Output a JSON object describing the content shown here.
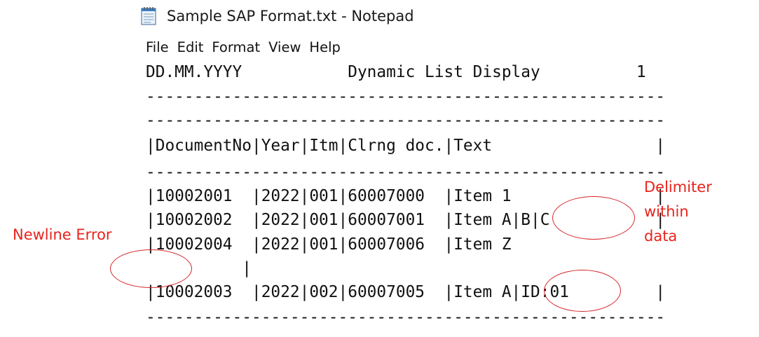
{
  "window": {
    "title": "Sample SAP Format.txt - Notepad",
    "icon": "notepad-icon"
  },
  "menu": [
    "File",
    "Edit",
    "Format",
    "View",
    "Help"
  ],
  "content": {
    "lines": [
      "DD.MM.YYYY           Dynamic List Display          1",
      "------------------------------------------------------",
      "------------------------------------------------------",
      "|DocumentNo|Year|Itm|Clrng doc.|Text                 |",
      "------------------------------------------------------",
      "|10002001  |2022|001|60007000  |Item 1               |",
      "|10002002  |2022|001|60007001  |Item A|B|C           |",
      "|10002004  |2022|001|60007006  |Item Z",
      "          |",
      "|10002003  |2022|002|60007005  |Item A|ID:01         |",
      "------------------------------------------------------"
    ]
  },
  "annotations": {
    "newline_error": "Newline Error",
    "delimiter": "Delimiter\nwithin\ndata"
  },
  "colors": {
    "annotation": "#e8231c",
    "text": "#111111"
  }
}
